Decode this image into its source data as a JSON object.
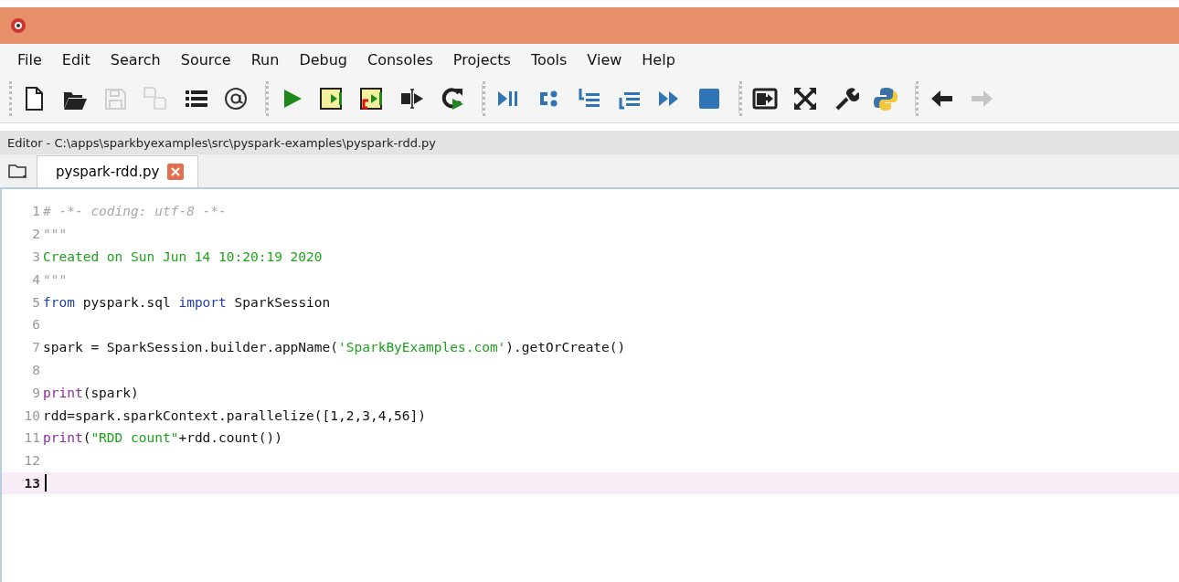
{
  "menu": [
    "File",
    "Edit",
    "Search",
    "Source",
    "Run",
    "Debug",
    "Consoles",
    "Projects",
    "Tools",
    "View",
    "Help"
  ],
  "toolbar": [
    [
      {
        "kind": "new",
        "disabled": false
      },
      {
        "kind": "open",
        "disabled": false
      },
      {
        "kind": "save",
        "disabled": true
      },
      {
        "kind": "save-all",
        "disabled": true
      },
      {
        "kind": "list",
        "disabled": false
      },
      {
        "kind": "at",
        "disabled": false
      }
    ],
    [
      {
        "kind": "run",
        "disabled": false
      },
      {
        "kind": "run-cell",
        "disabled": false
      },
      {
        "kind": "run-cell-advance",
        "disabled": false
      },
      {
        "kind": "run-selection",
        "disabled": false
      },
      {
        "kind": "rerun",
        "disabled": false
      }
    ],
    [
      {
        "kind": "debug",
        "disabled": false
      },
      {
        "kind": "step",
        "disabled": false
      },
      {
        "kind": "step-into",
        "disabled": false
      },
      {
        "kind": "step-return",
        "disabled": false
      },
      {
        "kind": "continue",
        "disabled": false
      },
      {
        "kind": "stop",
        "disabled": false
      }
    ],
    [
      {
        "kind": "maximize",
        "disabled": false
      },
      {
        "kind": "fullscreen",
        "disabled": false
      },
      {
        "kind": "preferences",
        "disabled": false
      },
      {
        "kind": "python",
        "disabled": false
      }
    ],
    [
      {
        "kind": "back",
        "disabled": false
      },
      {
        "kind": "forward",
        "disabled": true
      }
    ]
  ],
  "editor": {
    "path": "Editor - C:\\apps\\sparkbyexamples\\src\\pyspark-examples\\pyspark-rdd.py",
    "tabs": [
      {
        "label": "pyspark-rdd.py",
        "selected": true
      }
    ],
    "lines": [
      {
        "number": "1",
        "current": false,
        "tokens": [
          {
            "kind": "comment",
            "text": "# -*- coding: utf-8 -*-"
          }
        ]
      },
      {
        "number": "2",
        "current": false,
        "tokens": [
          {
            "kind": "quote",
            "text": "\"\"\""
          }
        ]
      },
      {
        "number": "3",
        "current": false,
        "tokens": [
          {
            "kind": "string",
            "text": "Created on Sun Jun 14 10:20:19 2020"
          }
        ]
      },
      {
        "number": "4",
        "current": false,
        "tokens": [
          {
            "kind": "quote",
            "text": "\"\"\""
          }
        ]
      },
      {
        "number": "5",
        "current": false,
        "tokens": [
          {
            "kind": "keyword",
            "text": "from"
          },
          {
            "kind": "plain",
            "text": " pyspark.sql "
          },
          {
            "kind": "keyword",
            "text": "import"
          },
          {
            "kind": "plain",
            "text": " SparkSession"
          }
        ]
      },
      {
        "number": "6",
        "current": false
      },
      {
        "number": "7",
        "current": false,
        "tokens": [
          {
            "kind": "plain",
            "text": "spark = SparkSession.builder.appName("
          },
          {
            "kind": "string",
            "text": "'SparkByExamples.com'"
          },
          {
            "kind": "plain",
            "text": ").getOrCreate()"
          }
        ]
      },
      {
        "number": "8",
        "current": false
      },
      {
        "number": "9",
        "current": false,
        "tokens": [
          {
            "kind": "builtin",
            "text": "print"
          },
          {
            "kind": "plain",
            "text": "(spark)"
          }
        ]
      },
      {
        "number": "10",
        "current": false,
        "tokens": [
          {
            "kind": "plain",
            "text": "rdd=spark.sparkContext.parallelize([1,2,3,4,56])"
          }
        ]
      },
      {
        "number": "11",
        "current": false,
        "tokens": [
          {
            "kind": "builtin",
            "text": "print"
          },
          {
            "kind": "plain",
            "text": "("
          },
          {
            "kind": "string",
            "text": "\"RDD count\""
          },
          {
            "kind": "plain",
            "text": "+rdd.count())"
          }
        ]
      },
      {
        "number": "12",
        "current": false
      },
      {
        "number": "13",
        "current": true
      }
    ]
  }
}
